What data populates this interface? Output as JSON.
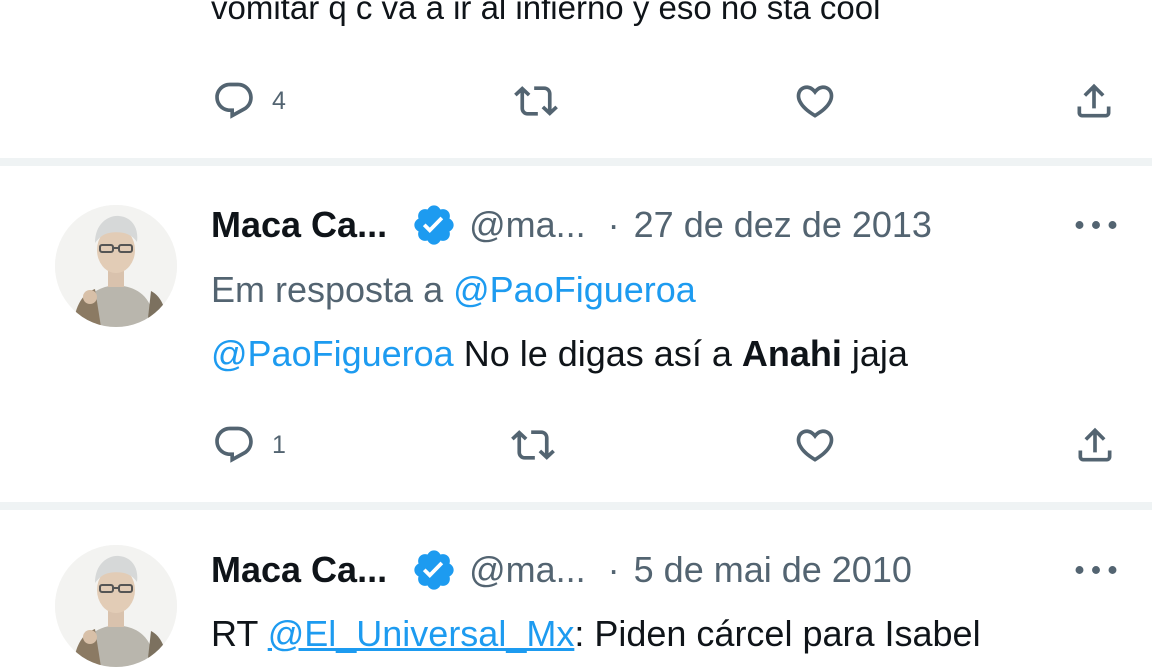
{
  "top_tweet": {
    "text_fragment": "vomitar q c va a ir al infierno y eso no sta cool",
    "reply_count": "4"
  },
  "tweets": [
    {
      "name": "Maca Ca...",
      "handle": "@ma...",
      "separator": "·",
      "date": "27 de dez de 2013",
      "reply_prefix": "Em resposta a",
      "reply_to": "@PaoFigueroa",
      "body_mention": "@PaoFigueroa",
      "body_text_1": "No le digas así a",
      "body_bold": "Anahi",
      "body_text_2": "jaja",
      "reply_count": "1"
    },
    {
      "name": "Maca Ca...",
      "handle": "@ma...",
      "separator": "·",
      "date": "5 de mai de 2010",
      "body_prefix": "RT",
      "body_mention": "@El_Universal_Mx",
      "body_text": ": Piden cárcel para Isabel"
    }
  ],
  "icons": {
    "reply": "speech-bubble-icon",
    "retweet": "retweet-icon",
    "like": "heart-icon",
    "share": "share-upload-icon",
    "more": "more-horizontal-icon",
    "verified": "verified-badge-icon"
  },
  "colors": {
    "link": "#1d9bf0",
    "muted": "#536471",
    "verified": "#1d9bf0",
    "divider": "#eff3f4"
  }
}
